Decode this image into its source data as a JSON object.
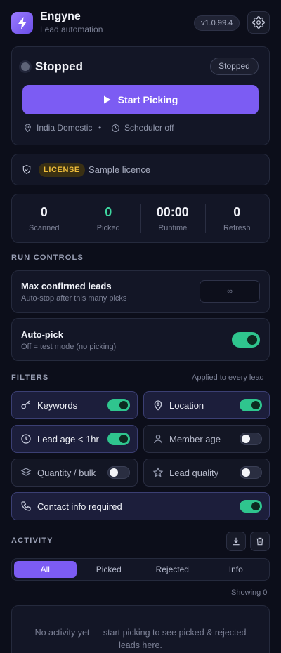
{
  "header": {
    "app_name": "Engyne",
    "app_subtitle": "Lead automation",
    "version": "v1.0.99.4",
    "logo_icon": "lightning-bolt-icon",
    "settings_icon": "gear-icon"
  },
  "status": {
    "title": "Stopped",
    "badge": "Stopped",
    "start_label": "Start Picking",
    "region": "India Domestic",
    "separator": "•",
    "scheduler": "Scheduler off"
  },
  "license": {
    "badge": "LICENSE",
    "text": "Sample licence"
  },
  "stats": [
    {
      "value": "0",
      "label": "Scanned"
    },
    {
      "value": "0",
      "label": "Picked"
    },
    {
      "value": "00:00",
      "label": "Runtime"
    },
    {
      "value": "0",
      "label": "Refresh"
    }
  ],
  "run_controls": {
    "section_label": "RUN CONTROLS",
    "max_title": "Max confirmed leads",
    "max_sub": "Auto-stop after this many picks",
    "max_placeholder": "∞",
    "autopick_title": "Auto-pick",
    "autopick_sub": "Off = test mode (no picking)",
    "autopick_on": true
  },
  "filters": {
    "section_label": "FILTERS",
    "note": "Applied to every lead",
    "items": [
      {
        "label": "Keywords",
        "icon": "key-icon",
        "on": true
      },
      {
        "label": "Location",
        "icon": "map-pin-icon",
        "on": true
      },
      {
        "label": "Lead age < 1hr",
        "icon": "clock-icon",
        "on": true
      },
      {
        "label": "Member age",
        "icon": "user-icon",
        "on": false
      },
      {
        "label": "Quantity / bulk",
        "icon": "layers-icon",
        "on": false
      },
      {
        "label": "Lead quality",
        "icon": "star-icon",
        "on": false
      },
      {
        "label": "Contact info required",
        "icon": "phone-icon",
        "on": true
      }
    ]
  },
  "activity": {
    "section_label": "ACTIVITY",
    "tabs": [
      "All",
      "Picked",
      "Rejected",
      "Info"
    ],
    "active_tab": "All",
    "showing": "Showing 0",
    "empty_text": "No activity yet — start picking to see picked & rejected leads here."
  },
  "colors": {
    "accent": "#7c5cf3",
    "success": "#3ed6a0",
    "license": "#f0be3b",
    "background": "#0c0e1a"
  }
}
